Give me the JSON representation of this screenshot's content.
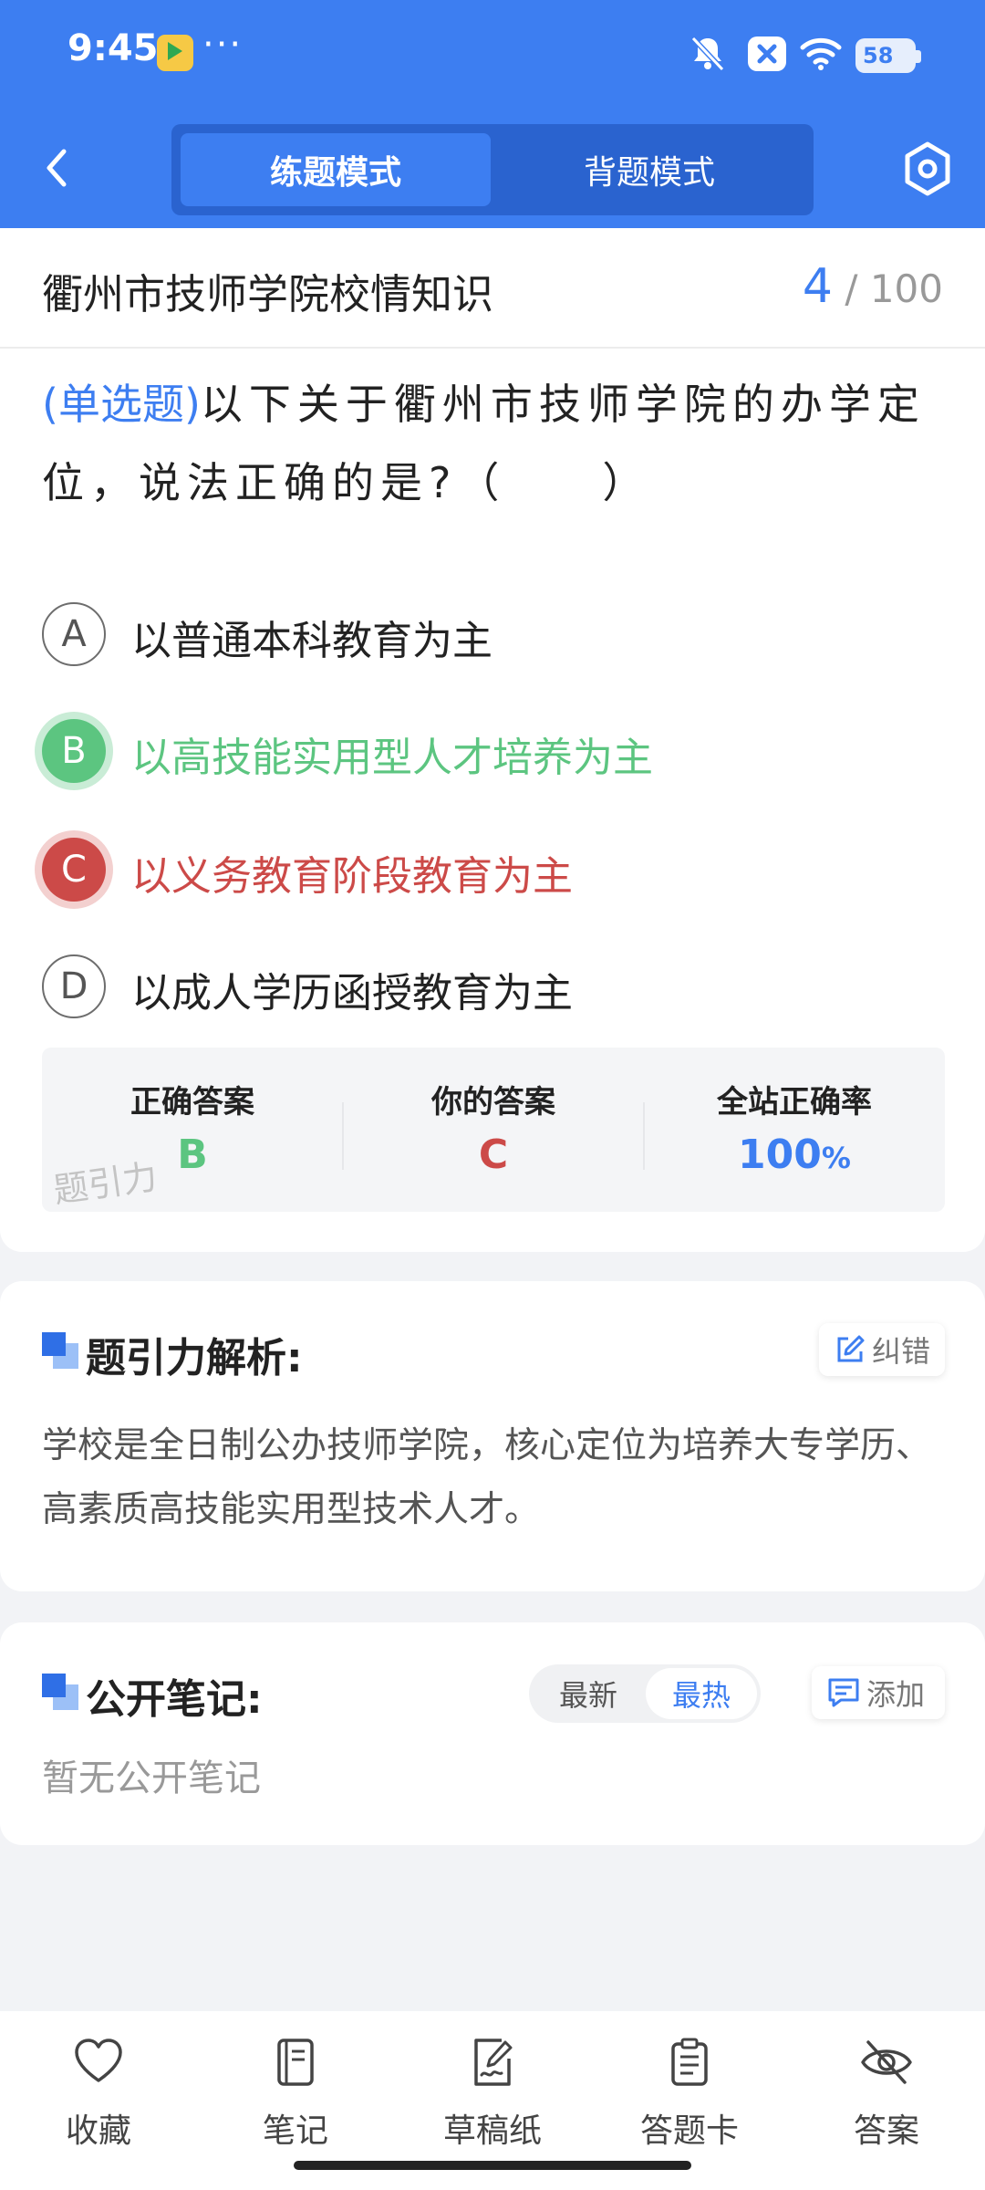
{
  "status_bar": {
    "time": "9:45",
    "more": "···",
    "battery": "58",
    "icons": [
      "app-icon",
      "bell-muted-icon",
      "x-badge-icon",
      "wifi-icon",
      "battery-icon"
    ]
  },
  "header": {
    "modes": [
      "练题模式",
      "背题模式"
    ],
    "active_mode": "练题模式",
    "colors": {
      "primary": "#3d7ef1",
      "switch_bg": "#2a63cf"
    }
  },
  "subject": {
    "title": "衢州市技师学院校情知识",
    "current": "4",
    "separator": "/",
    "total": "100"
  },
  "question": {
    "type": "(单选题)",
    "text": "以下关于衢州市技师学院的办学定位，说法正确的是?（　　）",
    "options": [
      {
        "letter": "A",
        "text": "以普通本科教育为主",
        "state": "normal"
      },
      {
        "letter": "B",
        "text": "以高技能实用型人才培养为主",
        "state": "correct"
      },
      {
        "letter": "C",
        "text": "以义务教育阶段教育为主",
        "state": "wrong"
      },
      {
        "letter": "D",
        "text": "以成人学历函授教育为主",
        "state": "normal"
      }
    ]
  },
  "answer_summary": {
    "correct_label": "正确答案",
    "correct_value": "B",
    "yours_label": "你的答案",
    "yours_value": "C",
    "rate_label": "全站正确率",
    "rate_value": "100",
    "rate_unit": "%",
    "watermark": "题引力",
    "colors": {
      "correct": "#5cc580",
      "wrong": "#cc4a48",
      "rate": "#3d7ef1"
    }
  },
  "analysis": {
    "title": "题引力解析:",
    "report_label": "纠错",
    "text": "学校是全日制公办技师学院，核心定位为培养大专学历、高素质高技能实用型技术人才。"
  },
  "notes": {
    "title": "公开笔记:",
    "sort_latest": "最新",
    "sort_hot": "最热",
    "add_label": "添加",
    "empty": "暂无公开笔记"
  },
  "bottom_bar": {
    "items": [
      {
        "label": "收藏",
        "icon": "heart-icon"
      },
      {
        "label": "笔记",
        "icon": "notebook-icon"
      },
      {
        "label": "草稿纸",
        "icon": "draft-icon"
      },
      {
        "label": "答题卡",
        "icon": "answer-sheet-icon"
      },
      {
        "label": "答案",
        "icon": "eye-off-icon"
      }
    ]
  }
}
